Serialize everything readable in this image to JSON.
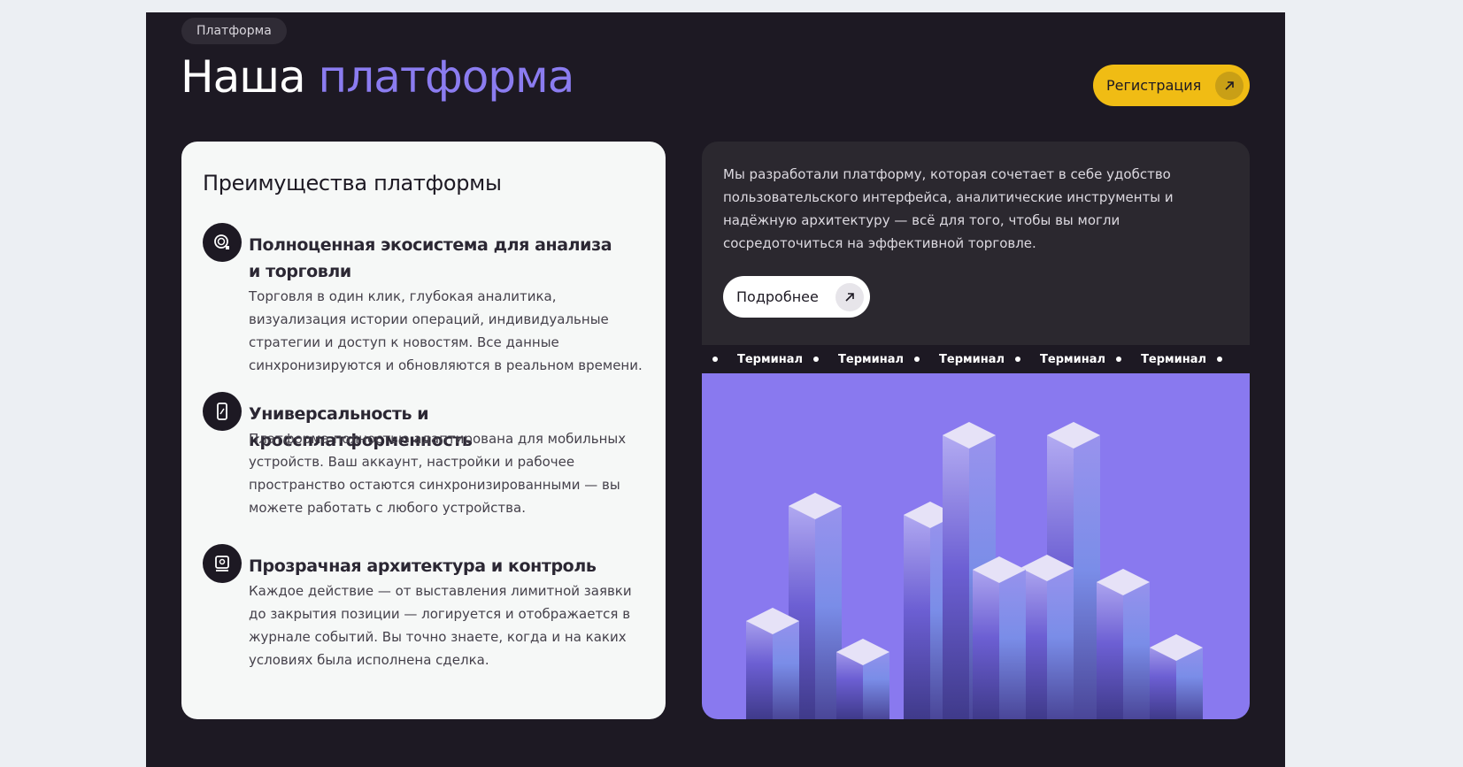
{
  "section": {
    "tag": "Платформа",
    "title_plain": "Наша",
    "title_accent": "платформа",
    "register_label": "Регистрация"
  },
  "advantages": {
    "title": "Преимущества платформы",
    "items": [
      {
        "icon": "coins-icon",
        "title": "Полноценная экосистема для анализа и торговли",
        "desc": "Торговля в один клик, глубокая аналитика, визуализация истории операций, индивидуальные стратегии и доступ к новостям. Все данные синхронизируются и обновляются в реальном времени."
      },
      {
        "icon": "mobile-icon",
        "title": "Универсальность и кроссплатформенность",
        "desc": "Платформа полностью адаптирована для мобильных устройств. Ваш аккаунт, настройки и рабочее пространство остаются синхронизированными — вы можете работать с любого устройства."
      },
      {
        "icon": "document-search-icon",
        "title": "Прозрачная архитектура и контроль",
        "desc": "Каждое действие — от выставления лимитной заявки до закрытия позиции — логируется и отображается в журнале событий. Вы точно знаете, когда и на каких условиях была исполнена сделка."
      }
    ]
  },
  "intro": {
    "text": "Мы разработали платформу, которая сочетает в себе удобство пользовательского интерфейса, аналитические инструменты и надёжную архитектуру — всё для того, чтобы вы могли сосредоточиться на эффективной торговле.",
    "more_label": "Подробнее"
  },
  "ticker": {
    "words": [
      "Терминал",
      "Терминал",
      "Терминал",
      "Терминал",
      "Терминал"
    ]
  },
  "colors": {
    "accent": "#8b7cf0",
    "button_yellow": "#f0bc14",
    "panel_bg": "#1d1923",
    "hero_bg": "#8979ef"
  }
}
